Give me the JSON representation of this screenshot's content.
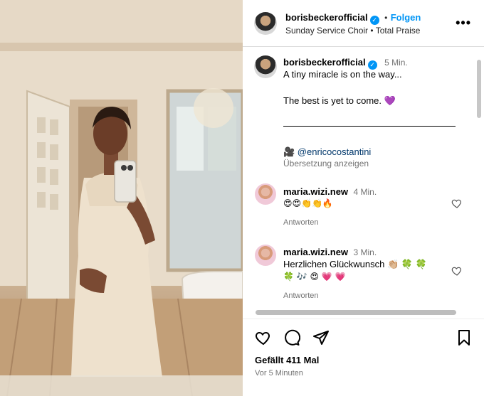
{
  "post": {
    "username": "borisbeckerofficial",
    "verified_glyph": "✓",
    "follow_sep": "•",
    "follow_label": "Folgen",
    "audio": "Sunday Service Choir • Total Praise",
    "more_icon": "more-icon"
  },
  "caption": {
    "username": "borisbeckerofficial",
    "time": "5 Min.",
    "line1": "A tiny miracle is on the way...",
    "line2": "The best is yet to come. 💜",
    "credit": "🎥 @enricocostantini",
    "translate": "Übersetzung anzeigen"
  },
  "comments": [
    {
      "username": "maria.wizi.new",
      "time": "4 Min.",
      "text": "😍😍👏👏🔥",
      "reply": "Antworten"
    },
    {
      "username": "maria.wizi.new",
      "time": "3 Min.",
      "text": "Herzlichen Glückwunsch 👏🏼 🍀 🍀",
      "text2": "🍀 🎶 😍 💗 💗",
      "reply": "Antworten"
    }
  ],
  "footer": {
    "likes": "Gefällt 411 Mal",
    "time": "Vor 5 Minuten"
  },
  "colors": {
    "accent": "#0095f6",
    "muted": "#737373",
    "link": "#00376b"
  }
}
